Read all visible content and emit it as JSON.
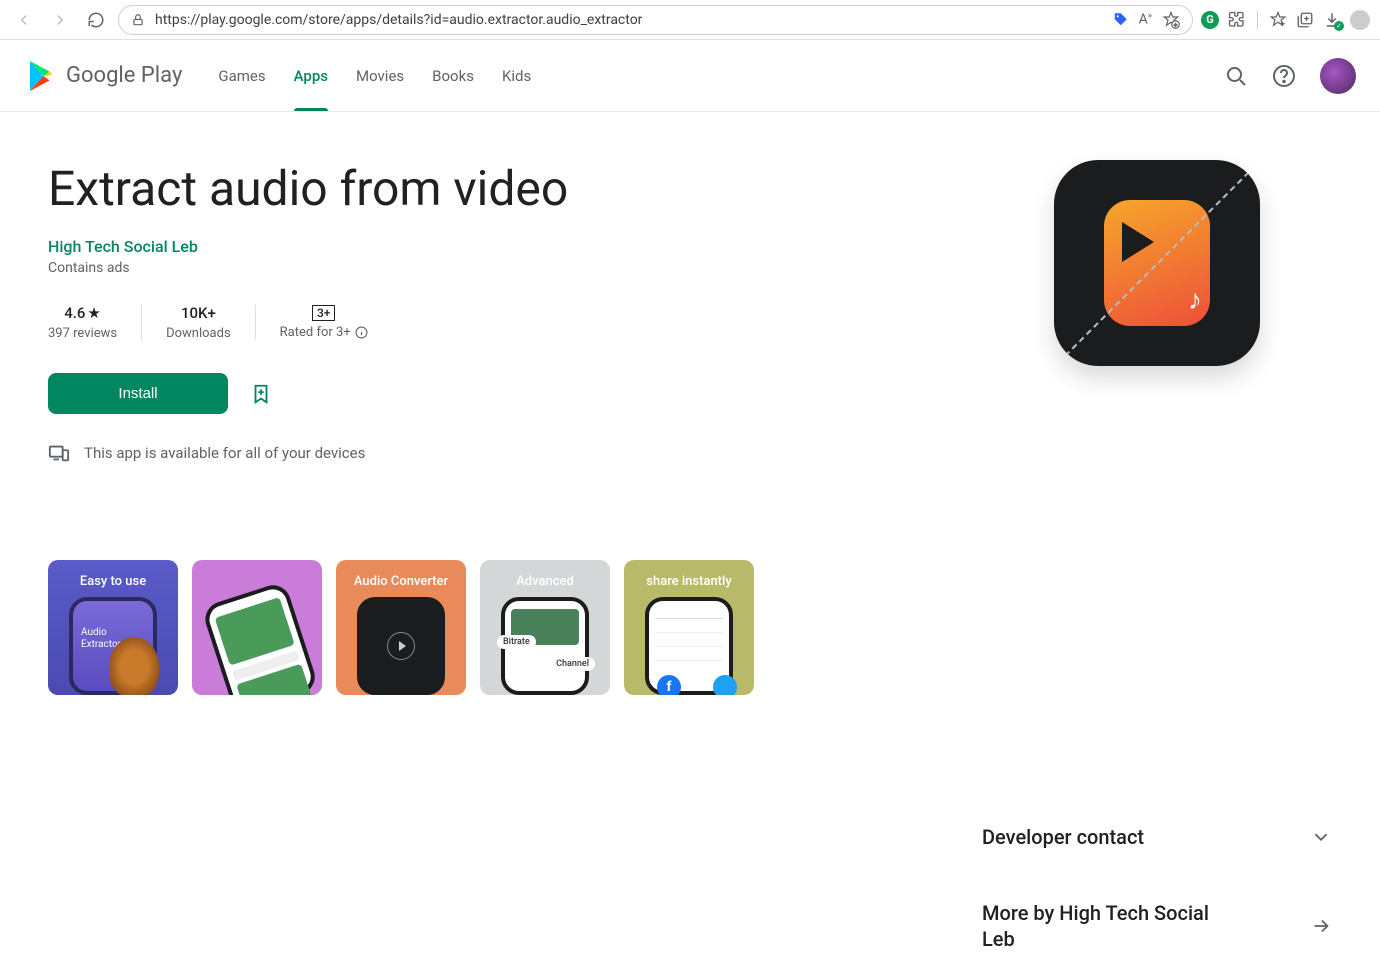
{
  "browser": {
    "url": "https://play.google.com/store/apps/details?id=audio.extractor.audio_extractor"
  },
  "header": {
    "logo": "Google Play",
    "nav": {
      "games": "Games",
      "apps": "Apps",
      "movies": "Movies",
      "books": "Books",
      "kids": "Kids"
    }
  },
  "app": {
    "title": "Extract audio from video",
    "developer": "High Tech Social Leb",
    "contains_ads": "Contains ads",
    "rating_value": "4.6",
    "reviews": "397 reviews",
    "downloads_value": "10K+",
    "downloads_label": "Downloads",
    "rated_box": "3+",
    "rated_label": "Rated for 3+",
    "install": "Install",
    "availability": "This app is available for all of your devices"
  },
  "shots": {
    "s1": "Easy to use",
    "s1_sub1": "Audio",
    "s1_sub2": "Extractor",
    "s2": "",
    "s3": "Audio Converter",
    "s4": "Advanced",
    "s4_chip1": "Bitrate",
    "s4_chip2": "Channel",
    "s5": "share instantly"
  },
  "right": {
    "dev_contact": "Developer contact",
    "more_by": "More by High Tech Social Leb"
  }
}
